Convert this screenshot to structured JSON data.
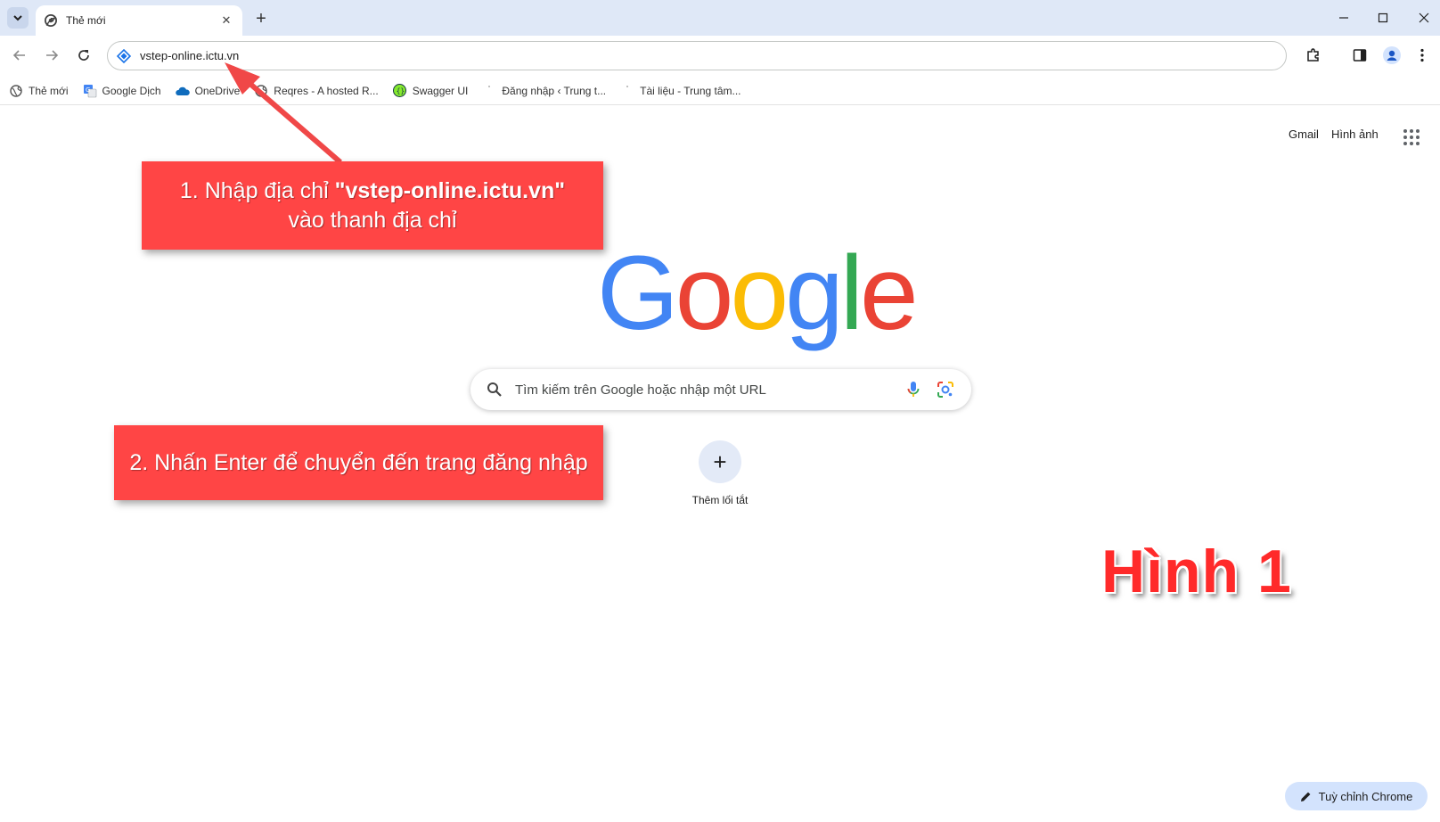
{
  "tab": {
    "title": "Thẻ mới"
  },
  "toolbar": {
    "url": "vstep-online.ictu.vn"
  },
  "bookmarks": [
    {
      "label": "Thẻ mới",
      "icon": "globe-icon"
    },
    {
      "label": "Google Dịch",
      "icon": "google-translate-icon"
    },
    {
      "label": "OneDrive",
      "icon": "onedrive-icon"
    },
    {
      "label": "Reqres - A hosted R...",
      "icon": "globe-icon"
    },
    {
      "label": "Swagger UI",
      "icon": "swagger-icon"
    },
    {
      "label": "Đăng nhập ‹ Trung t...",
      "icon": "dot-icon"
    },
    {
      "label": "Tài liệu - Trung tâm...",
      "icon": "dot-icon"
    }
  ],
  "top_links": {
    "gmail": "Gmail",
    "images": "Hình ảnh"
  },
  "logo": {
    "letters": [
      "G",
      "o",
      "o",
      "g",
      "l",
      "e"
    ],
    "colors": [
      "#4285F4",
      "#EA4335",
      "#FBBC05",
      "#4285F4",
      "#34A853",
      "#EA4335"
    ]
  },
  "search": {
    "placeholder": "Tìm kiếm trên Google hoặc nhập một URL"
  },
  "shortcut": {
    "label": "Thêm lối tắt"
  },
  "annotations": {
    "step1_prefix": "1. Nhập địa chỉ ",
    "step1_bold": "\"vstep-online.ictu.vn\"",
    "step1_suffix": " vào thanh địa chỉ",
    "step2": "2. Nhấn Enter để chuyển đến trang đăng nhập",
    "figure": "Hình 1"
  },
  "customize": {
    "label": "Tuỳ chỉnh Chrome"
  },
  "colors": {
    "callout": "#ff4545",
    "titlebar": "#dfe8f7",
    "accent": "#d3e3fd"
  }
}
